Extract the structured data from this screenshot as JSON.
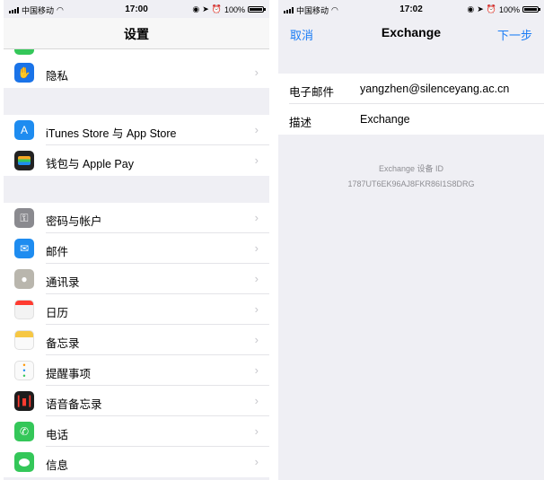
{
  "left": {
    "status": {
      "carrier": "中国移动",
      "time": "17:00",
      "battery": "100%"
    },
    "title": "设置",
    "groups": [
      [
        {
          "label": "隐私",
          "icon": "hand-icon",
          "color": "#1a73e8"
        }
      ],
      [
        {
          "label": "iTunes Store 与 App Store",
          "icon": "app-store-icon",
          "color": "#1e8cf0"
        },
        {
          "label": "钱包与 Apple Pay",
          "icon": "wallet-icon",
          "color": "#222222"
        }
      ],
      [
        {
          "label": "密码与帐户",
          "icon": "key-icon",
          "color": "#8a8a8f"
        },
        {
          "label": "邮件",
          "icon": "mail-icon",
          "color": "#1e8cf0"
        },
        {
          "label": "通讯录",
          "icon": "contacts-icon",
          "color": "#b9b6ad"
        },
        {
          "label": "日历",
          "icon": "calendar-icon",
          "color": "#f3f3f3"
        },
        {
          "label": "备忘录",
          "icon": "notes-icon",
          "color": "#f6c744"
        },
        {
          "label": "提醒事项",
          "icon": "reminders-icon",
          "color": "#f3f3f3"
        },
        {
          "label": "语音备忘录",
          "icon": "voice-memos-icon",
          "color": "#1c1c1c"
        },
        {
          "label": "电话",
          "icon": "phone-icon",
          "color": "#34c759"
        },
        {
          "label": "信息",
          "icon": "messages-icon",
          "color": "#34c759"
        }
      ]
    ]
  },
  "right": {
    "status": {
      "carrier": "中国移动",
      "time": "17:02",
      "battery": "100%"
    },
    "nav": {
      "cancel": "取消",
      "title": "Exchange",
      "next": "下一步"
    },
    "fields": [
      {
        "label": "电子邮件",
        "value": "yangzhen@silenceyang.ac.cn"
      },
      {
        "label": "描述",
        "value": "Exchange"
      }
    ],
    "footer": {
      "line1": "Exchange 设备 ID",
      "line2": "1787UT6EK96AJ8FKR86I1S8DRG"
    }
  },
  "colors": {
    "accent": "#1a7cf5",
    "background": "#efeff4"
  }
}
